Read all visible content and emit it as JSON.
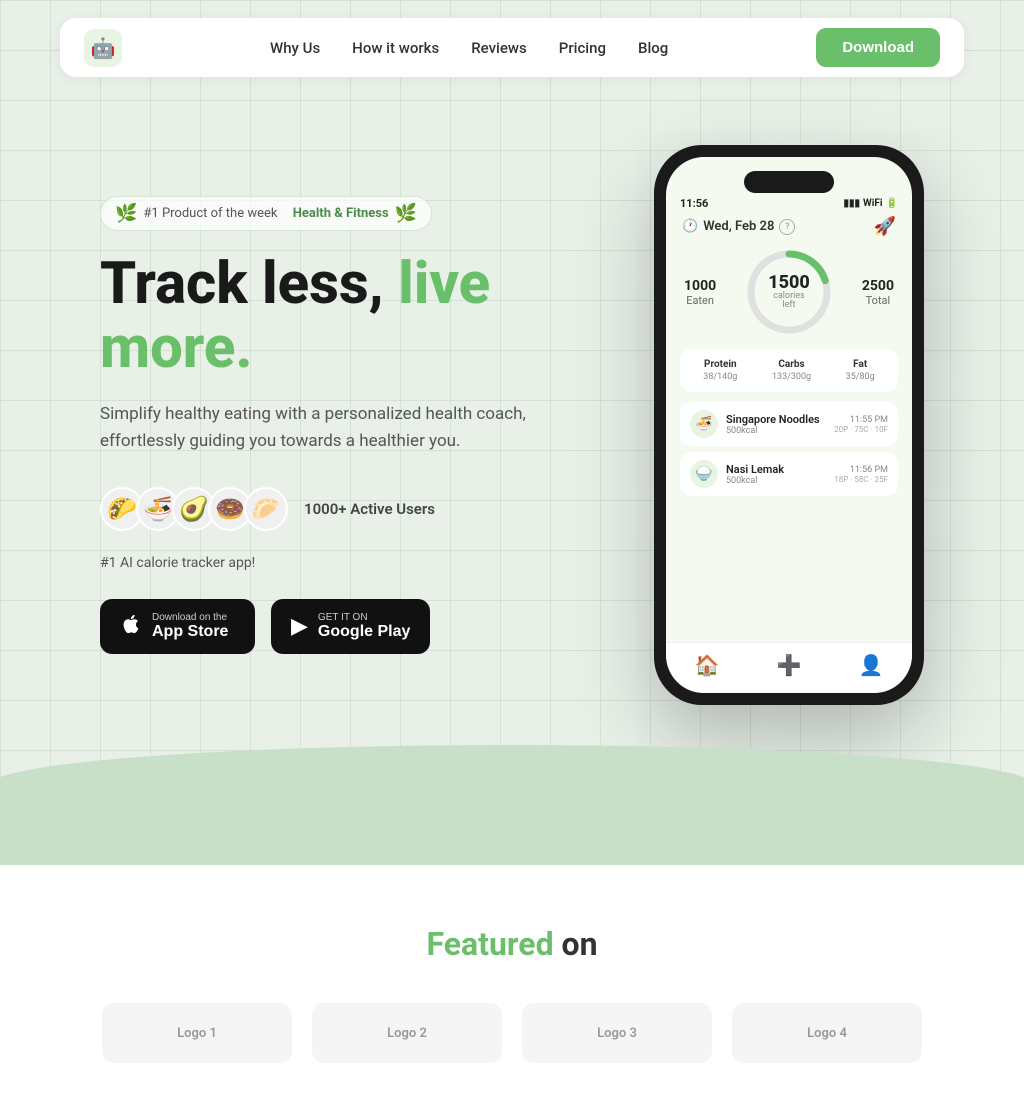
{
  "nav": {
    "logo_emoji": "🤖",
    "links": [
      {
        "label": "Why Us",
        "id": "why-us"
      },
      {
        "label": "How it works",
        "id": "how-it-works"
      },
      {
        "label": "Reviews",
        "id": "reviews"
      },
      {
        "label": "Pricing",
        "id": "pricing"
      },
      {
        "label": "Blog",
        "id": "blog"
      }
    ],
    "download_label": "Download"
  },
  "hero": {
    "badge": {
      "prefix": "#1 Product of the week",
      "highlight": "Health & Fitness"
    },
    "title_black": "Track less,",
    "title_green": " live more.",
    "description": "Simplify healthy eating with a personalized health coach, effortlessly guiding you towards a healthier you.",
    "active_users": "1000+ Active Users",
    "tagline": "#1 AI calorie tracker app!",
    "avatars": [
      "🌮",
      "🍜",
      "🥑",
      "🍩",
      "🥟"
    ],
    "app_store": {
      "small": "Download on the",
      "big": "App Store",
      "icon": "🍎"
    },
    "google_play": {
      "small": "GET IT ON",
      "big": "Google Play",
      "icon": "▶"
    }
  },
  "phone": {
    "time": "11:56",
    "date": "Wed, Feb 28",
    "calories": {
      "eaten_label": "Eaten",
      "eaten": "1000",
      "left_big": "1500",
      "left_label": "calories",
      "left_sublabel": "left",
      "total_label": "Total",
      "total": "2500"
    },
    "macros": [
      {
        "label": "Protein",
        "value": "38/140g"
      },
      {
        "label": "Carbs",
        "value": "133/300g"
      },
      {
        "label": "Fat",
        "value": "35/80g"
      }
    ],
    "food_log": [
      {
        "name": "Singapore Noodles",
        "calories": "500kcal",
        "time": "11:55 PM",
        "macros": "20P · 75C · 10F",
        "emoji": "🍜"
      },
      {
        "name": "Nasi Lemak",
        "calories": "500kcal",
        "time": "11:56 PM",
        "macros": "18P · 58C · 25F",
        "emoji": "🍚"
      }
    ],
    "nav_icons": [
      "🏠",
      "➕",
      "👤"
    ]
  },
  "featured": {
    "title_green": "Featured",
    "title_dark": " on",
    "logos": [
      "Logo 1",
      "Logo 2",
      "Logo 3",
      "Logo 4"
    ]
  }
}
